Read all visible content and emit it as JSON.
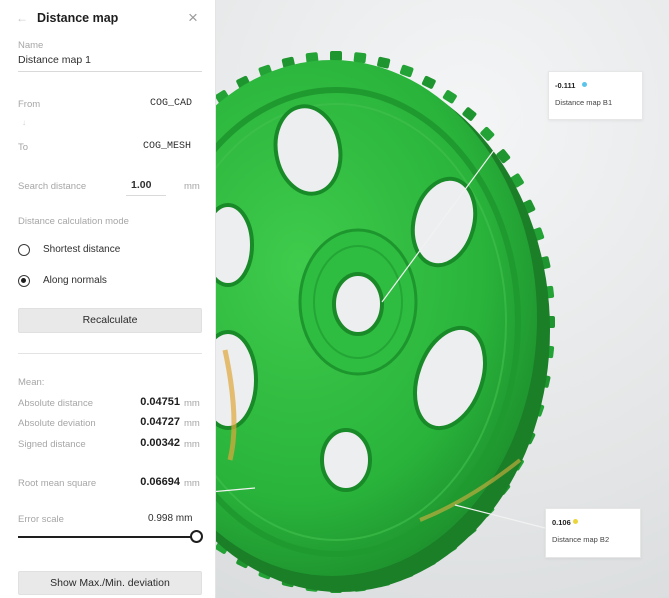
{
  "panel": {
    "title": "Distance map",
    "name_label": "Name",
    "name_value": "Distance map 1",
    "from_label": "From",
    "from_value": "COG_CAD",
    "to_label": "To",
    "to_value": "COG_MESH",
    "search_distance_label": "Search distance",
    "search_distance_value": "1.00",
    "search_distance_unit": "mm",
    "calc_mode_label": "Distance calculation mode",
    "radio_options": [
      {
        "label": "Shortest distance",
        "selected": false
      },
      {
        "label": "Along normals",
        "selected": true
      }
    ],
    "recalculate_label": "Recalculate",
    "mean_label": "Mean:",
    "stats": [
      {
        "label": "Absolute distance",
        "value": "0.04751",
        "unit": "mm"
      },
      {
        "label": "Absolute deviation",
        "value": "0.04727",
        "unit": "mm"
      },
      {
        "label": "Signed distance",
        "value": "0.00342",
        "unit": "mm"
      }
    ],
    "rms": {
      "label": "Root mean square",
      "value": "0.06694",
      "unit": "mm"
    },
    "error_scale_label": "Error scale",
    "error_scale_value": "0.998 mm",
    "error_scale_fraction": 1.0,
    "show_dev_label": "Show Max./Min. deviation"
  },
  "annotations": [
    {
      "value": "-0.111",
      "name": "Distance map B1",
      "dot_color": "#5bc4ea"
    },
    {
      "value": "0.106",
      "name": "Distance map B2",
      "dot_color": "#ecd53a"
    }
  ],
  "colors": {
    "gear_green": "#29b33b",
    "gear_dark": "#1f8f2e",
    "accent_dark": "#1e1e1e"
  }
}
